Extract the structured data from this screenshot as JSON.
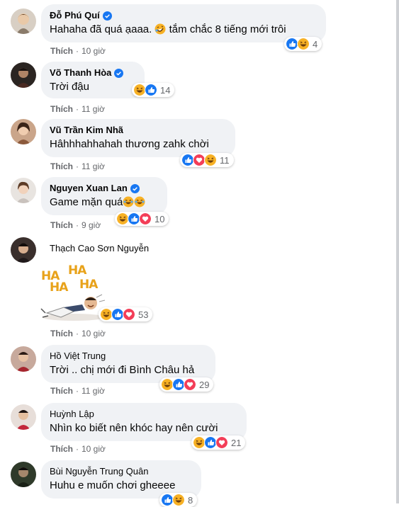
{
  "like_label": "Thích",
  "colors": {
    "bubble": "#f0f2f5",
    "meta": "#65676b",
    "verified": "#1877f2",
    "like_reaction": "#1877f2",
    "haha_reaction": "#f7b125",
    "love_reaction": "#f33e58"
  },
  "sticker": {
    "lines": [
      "HA",
      "HA",
      "HA",
      "HA"
    ]
  },
  "comments": [
    {
      "name": "Đỗ Phú Quí",
      "verified": true,
      "text": "Hahaha đã quá ạaaa.",
      "emoji": "rolling-laughing-emoji",
      "text_after": "tắm chắc 8 tiếng mới trôi",
      "time": "10 giờ",
      "reactions": [
        "like",
        "haha"
      ],
      "count": "4"
    },
    {
      "name": "Võ Thanh Hòa",
      "verified": true,
      "text": "Trời đậu",
      "time": "11 giờ",
      "reactions": [
        "haha",
        "like"
      ],
      "count": "14"
    },
    {
      "name": "Vũ Trần Kim Nhã",
      "verified": false,
      "text": "Hâhhhahhahah thương zahk chời",
      "time": "11 giờ",
      "reactions": [
        "like",
        "love",
        "haha"
      ],
      "count": "11"
    },
    {
      "name": "Nguyen Xuan Lan",
      "verified": true,
      "text": "Game mặn quá",
      "emoji": "laughing-emoji",
      "time": "9 giờ",
      "reactions": [
        "haha",
        "like",
        "love"
      ],
      "count": "10"
    },
    {
      "name": "Thạch Cao Sơn Nguyễn",
      "verified": false,
      "text": "",
      "time": "10 giờ",
      "reactions": [
        "haha",
        "like",
        "love"
      ],
      "count": "53"
    },
    {
      "name": "Hồ Việt Trung",
      "verified": false,
      "text": "Trời .. chị mới đi Bình Châu hả",
      "time": "11 giờ",
      "reactions": [
        "haha",
        "like",
        "love"
      ],
      "count": "29"
    },
    {
      "name": "Huỳnh Lập",
      "verified": false,
      "text": "Nhìn ko biết nên khóc hay nên cười",
      "time": "10 giờ",
      "reactions": [
        "haha",
        "like",
        "love"
      ],
      "count": "21"
    },
    {
      "name": "Bùi Nguyễn Trung Quân",
      "verified": false,
      "text": "Huhu e muốn chơi gheeee",
      "time": "",
      "reactions": [
        "like",
        "haha"
      ],
      "count": "8"
    }
  ]
}
